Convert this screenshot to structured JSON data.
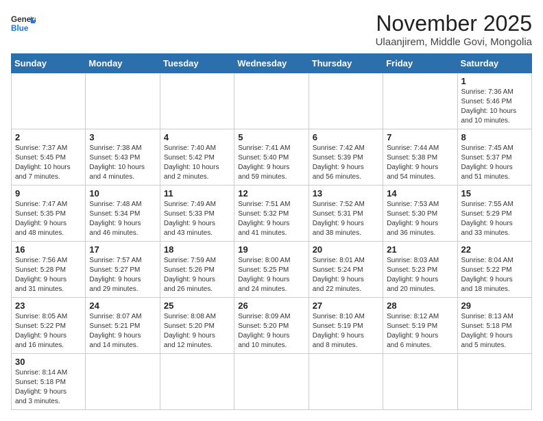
{
  "header": {
    "logo_general": "General",
    "logo_blue": "Blue",
    "title": "November 2025",
    "subtitle": "Ulaanjirem, Middle Govi, Mongolia"
  },
  "weekdays": [
    "Sunday",
    "Monday",
    "Tuesday",
    "Wednesday",
    "Thursday",
    "Friday",
    "Saturday"
  ],
  "weeks": [
    [
      {
        "day": "",
        "info": ""
      },
      {
        "day": "",
        "info": ""
      },
      {
        "day": "",
        "info": ""
      },
      {
        "day": "",
        "info": ""
      },
      {
        "day": "",
        "info": ""
      },
      {
        "day": "",
        "info": ""
      },
      {
        "day": "1",
        "info": "Sunrise: 7:36 AM\nSunset: 5:46 PM\nDaylight: 10 hours\nand 10 minutes."
      }
    ],
    [
      {
        "day": "2",
        "info": "Sunrise: 7:37 AM\nSunset: 5:45 PM\nDaylight: 10 hours\nand 7 minutes."
      },
      {
        "day": "3",
        "info": "Sunrise: 7:38 AM\nSunset: 5:43 PM\nDaylight: 10 hours\nand 4 minutes."
      },
      {
        "day": "4",
        "info": "Sunrise: 7:40 AM\nSunset: 5:42 PM\nDaylight: 10 hours\nand 2 minutes."
      },
      {
        "day": "5",
        "info": "Sunrise: 7:41 AM\nSunset: 5:40 PM\nDaylight: 9 hours\nand 59 minutes."
      },
      {
        "day": "6",
        "info": "Sunrise: 7:42 AM\nSunset: 5:39 PM\nDaylight: 9 hours\nand 56 minutes."
      },
      {
        "day": "7",
        "info": "Sunrise: 7:44 AM\nSunset: 5:38 PM\nDaylight: 9 hours\nand 54 minutes."
      },
      {
        "day": "8",
        "info": "Sunrise: 7:45 AM\nSunset: 5:37 PM\nDaylight: 9 hours\nand 51 minutes."
      }
    ],
    [
      {
        "day": "9",
        "info": "Sunrise: 7:47 AM\nSunset: 5:35 PM\nDaylight: 9 hours\nand 48 minutes."
      },
      {
        "day": "10",
        "info": "Sunrise: 7:48 AM\nSunset: 5:34 PM\nDaylight: 9 hours\nand 46 minutes."
      },
      {
        "day": "11",
        "info": "Sunrise: 7:49 AM\nSunset: 5:33 PM\nDaylight: 9 hours\nand 43 minutes."
      },
      {
        "day": "12",
        "info": "Sunrise: 7:51 AM\nSunset: 5:32 PM\nDaylight: 9 hours\nand 41 minutes."
      },
      {
        "day": "13",
        "info": "Sunrise: 7:52 AM\nSunset: 5:31 PM\nDaylight: 9 hours\nand 38 minutes."
      },
      {
        "day": "14",
        "info": "Sunrise: 7:53 AM\nSunset: 5:30 PM\nDaylight: 9 hours\nand 36 minutes."
      },
      {
        "day": "15",
        "info": "Sunrise: 7:55 AM\nSunset: 5:29 PM\nDaylight: 9 hours\nand 33 minutes."
      }
    ],
    [
      {
        "day": "16",
        "info": "Sunrise: 7:56 AM\nSunset: 5:28 PM\nDaylight: 9 hours\nand 31 minutes."
      },
      {
        "day": "17",
        "info": "Sunrise: 7:57 AM\nSunset: 5:27 PM\nDaylight: 9 hours\nand 29 minutes."
      },
      {
        "day": "18",
        "info": "Sunrise: 7:59 AM\nSunset: 5:26 PM\nDaylight: 9 hours\nand 26 minutes."
      },
      {
        "day": "19",
        "info": "Sunrise: 8:00 AM\nSunset: 5:25 PM\nDaylight: 9 hours\nand 24 minutes."
      },
      {
        "day": "20",
        "info": "Sunrise: 8:01 AM\nSunset: 5:24 PM\nDaylight: 9 hours\nand 22 minutes."
      },
      {
        "day": "21",
        "info": "Sunrise: 8:03 AM\nSunset: 5:23 PM\nDaylight: 9 hours\nand 20 minutes."
      },
      {
        "day": "22",
        "info": "Sunrise: 8:04 AM\nSunset: 5:22 PM\nDaylight: 9 hours\nand 18 minutes."
      }
    ],
    [
      {
        "day": "23",
        "info": "Sunrise: 8:05 AM\nSunset: 5:22 PM\nDaylight: 9 hours\nand 16 minutes."
      },
      {
        "day": "24",
        "info": "Sunrise: 8:07 AM\nSunset: 5:21 PM\nDaylight: 9 hours\nand 14 minutes."
      },
      {
        "day": "25",
        "info": "Sunrise: 8:08 AM\nSunset: 5:20 PM\nDaylight: 9 hours\nand 12 minutes."
      },
      {
        "day": "26",
        "info": "Sunrise: 8:09 AM\nSunset: 5:20 PM\nDaylight: 9 hours\nand 10 minutes."
      },
      {
        "day": "27",
        "info": "Sunrise: 8:10 AM\nSunset: 5:19 PM\nDaylight: 9 hours\nand 8 minutes."
      },
      {
        "day": "28",
        "info": "Sunrise: 8:12 AM\nSunset: 5:19 PM\nDaylight: 9 hours\nand 6 minutes."
      },
      {
        "day": "29",
        "info": "Sunrise: 8:13 AM\nSunset: 5:18 PM\nDaylight: 9 hours\nand 5 minutes."
      }
    ],
    [
      {
        "day": "30",
        "info": "Sunrise: 8:14 AM\nSunset: 5:18 PM\nDaylight: 9 hours\nand 3 minutes."
      },
      {
        "day": "",
        "info": ""
      },
      {
        "day": "",
        "info": ""
      },
      {
        "day": "",
        "info": ""
      },
      {
        "day": "",
        "info": ""
      },
      {
        "day": "",
        "info": ""
      },
      {
        "day": "",
        "info": ""
      }
    ]
  ]
}
